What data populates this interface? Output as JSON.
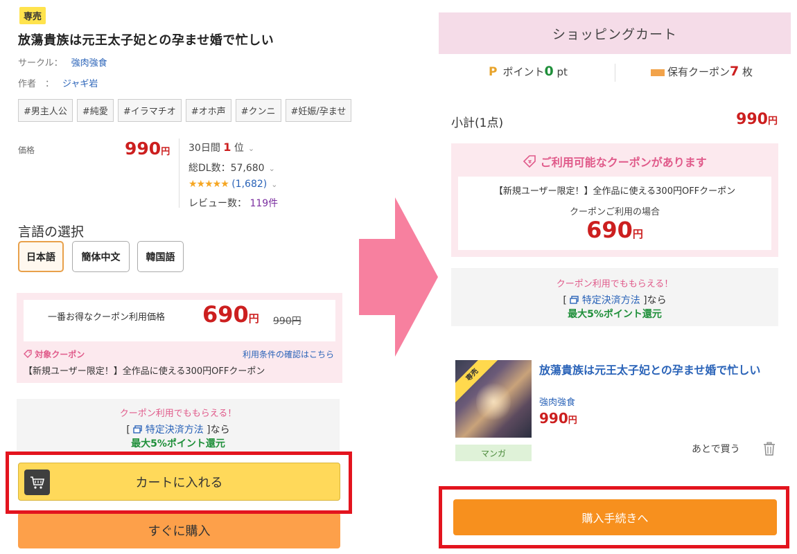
{
  "left": {
    "exclusive_badge": "専売",
    "title": "放蕩貴族は元王太子妃との孕ませ婚で忙しい",
    "circle_label": "サークル：",
    "circle_name": "強肉強食",
    "author_label": "作者　：",
    "author_name": "ジャギ岩",
    "tags": [
      "#男主人公",
      "#純愛",
      "#イラマチオ",
      "#オホ声",
      "#クンニ",
      "#妊娠/孕ませ"
    ],
    "price_label": "価格",
    "price": "990",
    "yen": "円",
    "ranking_prefix": "30日間",
    "ranking_value": "1",
    "ranking_suffix": "位",
    "downloads": "総DL数：57,680",
    "stars": "★★★★★",
    "rating_count": "(1,682)",
    "review_label": "レビュー数：",
    "review_count": "119件",
    "language_title": "言語の選択",
    "languages": [
      "日本語",
      "簡体中文",
      "韓国語"
    ],
    "coupon": {
      "label": "一番お得なクーポン利用価格",
      "price": "690",
      "yen": "円",
      "original": "990円",
      "target_label": "対象クーポン",
      "terms_link": "利用条件の確認はこちら",
      "description": "【新規ユーザー限定！】全作品に使える300円OFFクーポン"
    },
    "points": {
      "line1": "クーポン利用でももらえる！",
      "line2_prefix": "[",
      "line2_link": "特定決済方法",
      "line2_suffix": "]なら",
      "line3": "最大5%ポイント還元"
    },
    "cart_button": "カートに入れる",
    "buy_button": "すぐに購入"
  },
  "right": {
    "header": "ショッピングカート",
    "points_label": "ポイント",
    "points_value": "0",
    "points_unit": "pt",
    "coupons_label": "保有クーポン",
    "coupons_value": "7",
    "coupons_unit": "枚",
    "subtotal_label": "小計(1点)",
    "subtotal_price": "990",
    "yen": "円",
    "coupon_available": "ご利用可能なクーポンがあります",
    "coupon_desc": "【新規ユーザー限定！】全作品に使える300円OFFクーポン",
    "coupon_sub": "クーポンご利用の場合",
    "coupon_price": "690",
    "points": {
      "line1": "クーポン利用でももらえる！",
      "line2_prefix": "[",
      "line2_link": "特定決済方法",
      "line2_suffix": "]なら",
      "line3": "最大5%ポイント還元"
    },
    "item": {
      "badge": "専売",
      "title": "放蕩貴族は元王太子妃との孕ませ婚で忙しい",
      "circle": "強肉強食",
      "price": "990",
      "category": "マンガ",
      "save_later": "あとで買う"
    },
    "checkout_button": "購入手続きへ"
  },
  "colors": {
    "accent_red": "#cc1f1f",
    "link_blue": "#2a63b8",
    "coupon_pink": "#fce9ee",
    "cart_yellow": "#ffd95a",
    "buy_orange": "#fda04a",
    "checkout_orange": "#f7901e",
    "highlight_red": "#e3141e",
    "arrow_pink": "#f7809f"
  },
  "icons": [
    "cart-icon",
    "coupon-tag-icon",
    "external-window-icon",
    "ticket-icon",
    "trash-icon",
    "chevron-down-icon",
    "arrow-right-icon"
  ]
}
